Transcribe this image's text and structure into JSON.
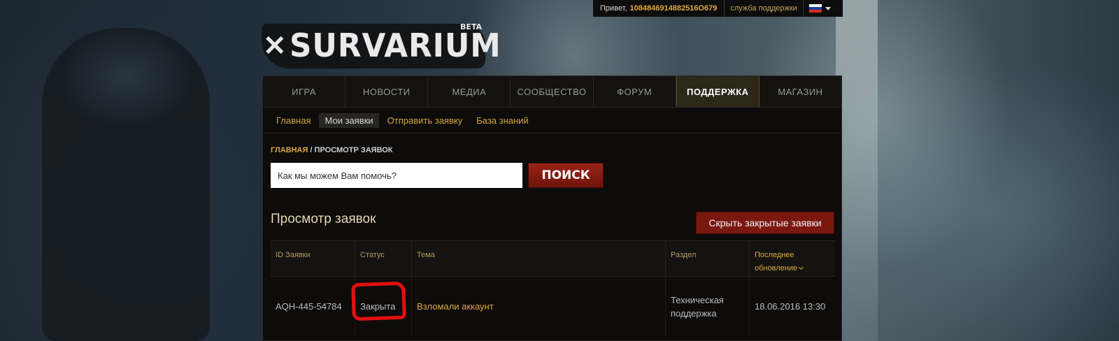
{
  "userbar": {
    "greeting": "Привет,",
    "user_id": "1084846914882516O679",
    "support": "служба поддержки",
    "flag_colors": [
      "#ffffff",
      "#1c3fa8",
      "#d52b1e"
    ]
  },
  "logo": {
    "text": "SURVARIUM",
    "badge": "BETA"
  },
  "main_nav": [
    {
      "label": "Игра",
      "active": false
    },
    {
      "label": "Новости",
      "active": false
    },
    {
      "label": "Медиа",
      "active": false
    },
    {
      "label": "Сообщество",
      "active": false
    },
    {
      "label": "Форум",
      "active": false
    },
    {
      "label": "Поддержка",
      "active": true
    },
    {
      "label": "Магазин",
      "active": false
    }
  ],
  "sub_nav": [
    {
      "label": "Главная",
      "active": false
    },
    {
      "label": "Мои заявки",
      "active": true
    },
    {
      "label": "Отправить заявку",
      "active": false
    },
    {
      "label": "База знаний",
      "active": false
    }
  ],
  "breadcrumb": {
    "home": "Главная",
    "separator": " / ",
    "current": "Просмотр заявок"
  },
  "search": {
    "placeholder": "Как мы можем Вам помочь?",
    "button": "Поиск"
  },
  "tickets": {
    "title": "Просмотр заявок",
    "hide_closed_button": "Скрыть закрытые заявки",
    "columns": {
      "id": "ID Заявки",
      "status": "Статус",
      "topic": "Тема",
      "section": "Раздел",
      "updated": "Последнее обновление"
    },
    "rows": [
      {
        "id": "AQH-445-54784",
        "status": "Закрыта",
        "topic": "Взломали аккаунт",
        "section": "Техническая поддержка",
        "updated": "18.06.2016 13:30"
      }
    ]
  },
  "colors": {
    "accent": "#e0a93a",
    "button_red": "#7a1810",
    "annotation_red": "#e31010",
    "panel_bg": "#0d0c0b"
  }
}
